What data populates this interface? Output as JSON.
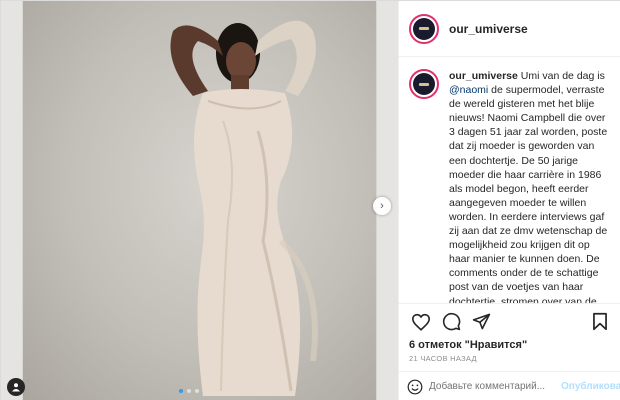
{
  "post": {
    "username": "our_umiverse",
    "caption": {
      "username": "our_umiverse",
      "text_before_mention": " Umi van de dag is ",
      "mention": "@naomi",
      "text_after_mention": " de supermodel, verraste de wereld gisteren met het blije nieuws! Naomi Campbell die over 3 dagen 51 jaar zal worden, poste dat zij moeder is geworden van een dochtertje. De 50 jarige moeder die haar carrière in 1986 als model begon, heeft eerder aangegeven moeder te willen worden. In eerdere interviews gaf zij aan dat ze dmv wetenschap de mogelijkheid zou krijgen dit op haar manier te kunnen doen. De comments onder de te schattige post van de voetjes van haar dochtertje, stromen over van de felicitaties. Helaas is er op andere profielen heel wat kritiek te vinden omtrent haar leeftijd. Hier heb ik echter de volgende reactie op: Geen moeder is te oud om een kind te hebben"
    },
    "likes": "6 отметок \"Нравится\"",
    "timestamp": "21 ЧАСОВ НАЗАД",
    "comment_placeholder": "Добавьте комментарий...",
    "publish_label": "Опубликовать"
  },
  "media": {
    "carousel_dots": 3,
    "active_dot": 0
  },
  "colors": {
    "link": "#00376b",
    "publish_disabled": "#b2dffc",
    "story_ring": "#e1306c"
  },
  "icons": [
    "heart-icon",
    "comment-icon",
    "share-icon",
    "bookmark-icon",
    "emoji-icon",
    "chevron-right-icon",
    "user-tag-icon"
  ]
}
